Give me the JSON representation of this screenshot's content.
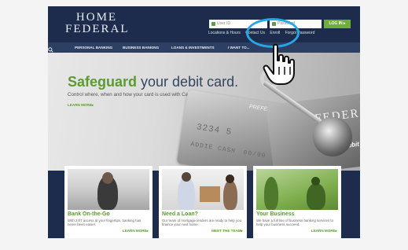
{
  "header": {
    "logo_line1": "HOME",
    "logo_line2": "FEDERAL",
    "user_placeholder": "User ID",
    "pass_placeholder": "Password",
    "login_label": "LOG IN ▸",
    "links": [
      "Locations & Hours",
      "Contact Us",
      "Enroll",
      "Forgot Password"
    ]
  },
  "nav": {
    "items": [
      "PERSONAL BANKING",
      "BUSINESS BANKING",
      "LOANS & INVESTMENTS",
      "I WANT TO..."
    ]
  },
  "hero": {
    "title_strong": "Safeguard",
    "title_rest": " your debit card.",
    "subtitle": "Control where, when and how your card is used with CardValet.",
    "link": "LEARN MORE▸",
    "card_word": "PREFERRED",
    "card_brand": "FEDERAL",
    "card_debit": "Debit",
    "card_number": "3234 5",
    "card_name": "ADDIE CASH",
    "card_date": "00/00",
    "carousel_dots": 3,
    "carousel_active": 1
  },
  "tiles": [
    {
      "title": "Bank On-the-Go",
      "text": "With 24/7 access at your fingertips, banking has never been easier.",
      "link": "LEARN MORE▸"
    },
    {
      "title": "Need a Loan?",
      "text": "Our team of mortgage lenders are ready to help you finance your next home.",
      "link": "MEET THE TEAM▸"
    },
    {
      "title": "Your Business",
      "text": "We have a full line of business banking services to help your business succeed.",
      "link": "LEARN MORE▸"
    }
  ],
  "colors": {
    "navy": "#1d2c4c",
    "green": "#5b9b2f",
    "highlight": "#28a6e4"
  }
}
